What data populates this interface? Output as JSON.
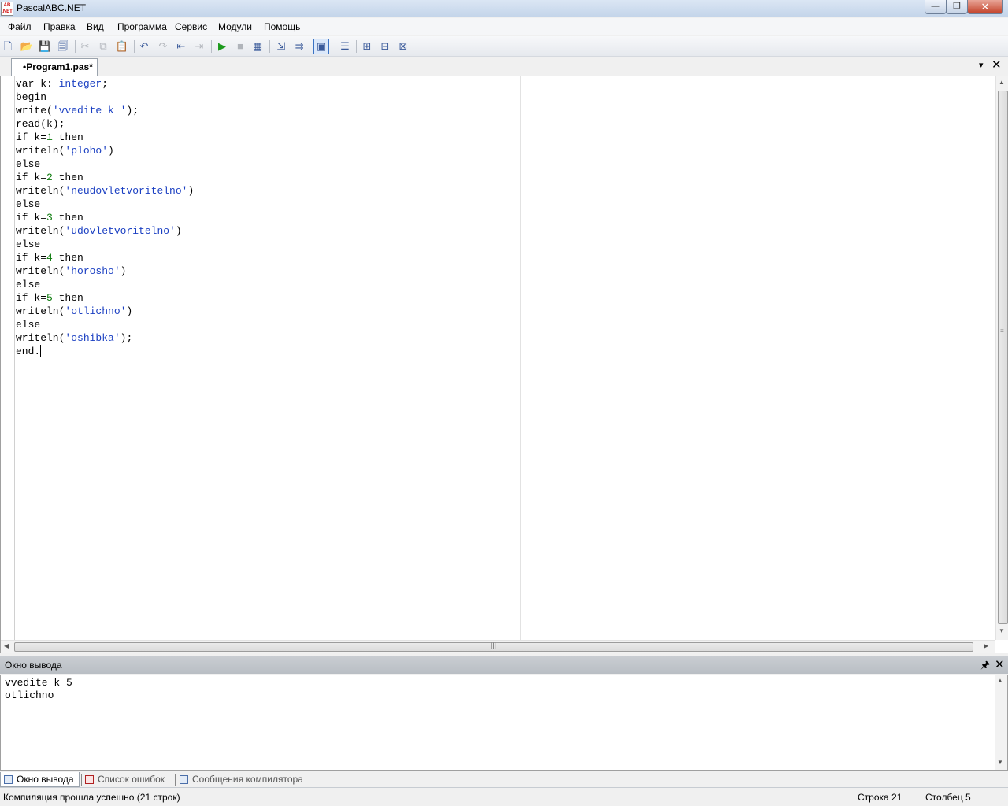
{
  "window": {
    "title": "PascalABC.NET",
    "min_glyph": "—",
    "max_glyph": "❐",
    "close_glyph": "✕"
  },
  "menu": [
    "Файл",
    "Правка",
    "Вид",
    "Программа",
    "Сервис",
    "Модули",
    "Помощь"
  ],
  "toolbar": {
    "icons": [
      "new-file-icon",
      "open-folder-icon",
      "save-icon",
      "save-all-icon",
      "cut-icon",
      "copy-icon",
      "paste-icon",
      "undo-icon",
      "redo-icon",
      "navigate-back-icon",
      "navigate-forward-icon",
      "run-icon",
      "stop-icon",
      "debug-icon",
      "step-into-icon",
      "step-over-icon",
      "output-window-icon",
      "format-code-icon",
      "templates-icon",
      "tools-icon",
      "form-designer-icon"
    ]
  },
  "document_tab": {
    "label": "•Program1.pas*",
    "menu_glyph": "▾",
    "close_glyph": "✕"
  },
  "editor": {
    "lines": [
      [
        {
          "t": "var k: ",
          "c": "kw"
        },
        {
          "t": "integer",
          "c": "ty"
        },
        {
          "t": ";",
          "c": "kw"
        }
      ],
      [
        {
          "t": "begin",
          "c": "kw"
        }
      ],
      [
        {
          "t": "write(",
          "c": "kw"
        },
        {
          "t": "'vvedite k '",
          "c": "str"
        },
        {
          "t": ");",
          "c": "kw"
        }
      ],
      [
        {
          "t": "read(k);",
          "c": "kw"
        }
      ],
      [
        {
          "t": "if k=",
          "c": "kw"
        },
        {
          "t": "1",
          "c": "num"
        },
        {
          "t": " then",
          "c": "kw"
        }
      ],
      [
        {
          "t": "writeln(",
          "c": "kw"
        },
        {
          "t": "'ploho'",
          "c": "str"
        },
        {
          "t": ")",
          "c": "kw"
        }
      ],
      [
        {
          "t": "else",
          "c": "kw"
        }
      ],
      [
        {
          "t": "if k=",
          "c": "kw"
        },
        {
          "t": "2",
          "c": "num"
        },
        {
          "t": " then",
          "c": "kw"
        }
      ],
      [
        {
          "t": "writeln(",
          "c": "kw"
        },
        {
          "t": "'neudovletvoritelno'",
          "c": "str"
        },
        {
          "t": ")",
          "c": "kw"
        }
      ],
      [
        {
          "t": "else",
          "c": "kw"
        }
      ],
      [
        {
          "t": "if k=",
          "c": "kw"
        },
        {
          "t": "3",
          "c": "num"
        },
        {
          "t": " then",
          "c": "kw"
        }
      ],
      [
        {
          "t": "writeln(",
          "c": "kw"
        },
        {
          "t": "'udovletvoritelno'",
          "c": "str"
        },
        {
          "t": ")",
          "c": "kw"
        }
      ],
      [
        {
          "t": "else",
          "c": "kw"
        }
      ],
      [
        {
          "t": "if k=",
          "c": "kw"
        },
        {
          "t": "4",
          "c": "num"
        },
        {
          "t": " then",
          "c": "kw"
        }
      ],
      [
        {
          "t": "writeln(",
          "c": "kw"
        },
        {
          "t": "'horosho'",
          "c": "str"
        },
        {
          "t": ")",
          "c": "kw"
        }
      ],
      [
        {
          "t": "else",
          "c": "kw"
        }
      ],
      [
        {
          "t": "if k=",
          "c": "kw"
        },
        {
          "t": "5",
          "c": "num"
        },
        {
          "t": " then",
          "c": "kw"
        }
      ],
      [
        {
          "t": "writeln(",
          "c": "kw"
        },
        {
          "t": "'otlichno'",
          "c": "str"
        },
        {
          "t": ")",
          "c": "kw"
        }
      ],
      [
        {
          "t": "else",
          "c": "kw"
        }
      ],
      [
        {
          "t": "writeln(",
          "c": "kw"
        },
        {
          "t": "'oshibka'",
          "c": "str"
        },
        {
          "t": ");",
          "c": "kw"
        }
      ],
      [
        {
          "t": "end.",
          "c": "kw"
        }
      ]
    ],
    "colors": {
      "keyword": "#000000",
      "type": "#1a3fc2",
      "string": "#1a3fc2",
      "number": "#0b7a0b"
    }
  },
  "output_panel": {
    "title": "Окно вывода",
    "pin_glyph": "📌",
    "close_glyph": "✕",
    "lines": [
      "vvedite k 5",
      "otlichno"
    ]
  },
  "bottom_tabs": [
    "Окно вывода",
    "Список ошибок",
    "Сообщения компилятора"
  ],
  "status": {
    "message": "Компиляция прошла успешно (21 строк)",
    "line_label": "Строка  21",
    "col_label": "Столбец  5"
  }
}
